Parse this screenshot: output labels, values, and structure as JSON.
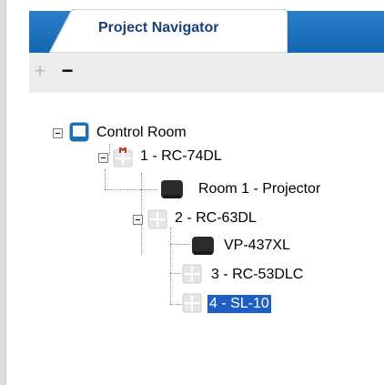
{
  "navigator": {
    "tab_label": "Project Navigator"
  },
  "toolbar": {
    "add_symbol": "+",
    "remove_symbol": "−"
  },
  "tree": {
    "items": [
      {
        "label": "Control Room",
        "icon": "room-icon",
        "selected": false
      },
      {
        "label": "1 - RC-74DL",
        "icon": "controller-alert-icon",
        "selected": false
      },
      {
        "label": "Room 1 - Projector",
        "icon": "projector-icon",
        "selected": false
      },
      {
        "label": "2 - RC-63DL",
        "icon": "controller-icon",
        "selected": false
      },
      {
        "label": "VP-437XL",
        "icon": "device-icon",
        "selected": false
      },
      {
        "label": "3 - RC-53DLC",
        "icon": "controller-icon",
        "selected": false
      },
      {
        "label": "4 - SL-10",
        "icon": "controller-icon",
        "selected": true
      }
    ]
  },
  "colors": {
    "tab_bar": "#1e73be",
    "tab_text": "#1a3f7a",
    "selection": "#1f5fbf",
    "room_icon": "#1f6fb2",
    "alert": "#c0392b"
  }
}
